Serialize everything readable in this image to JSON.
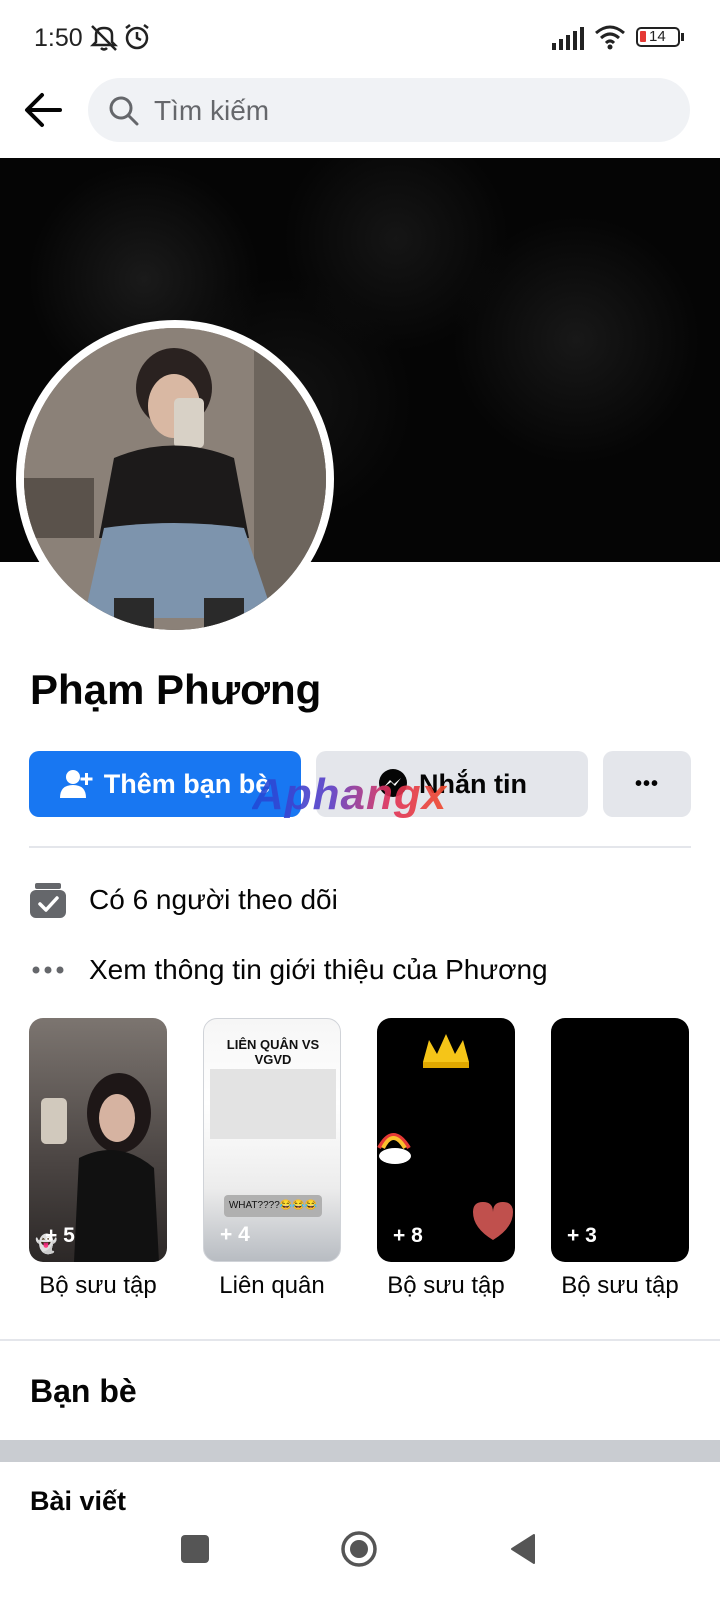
{
  "status_bar": {
    "time": "1:50",
    "battery": "14",
    "icons": [
      "mute-icon",
      "alarm-icon",
      "signal-icon",
      "wifi-icon",
      "battery-icon"
    ]
  },
  "search": {
    "placeholder": "Tìm kiếm"
  },
  "profile": {
    "name": "Phạm Phương",
    "add_friend_label": "Thêm bạn bè",
    "message_label": "Nhắn tin",
    "more_label": "•••",
    "followers_text": "Có 6 người theo dõi",
    "about_text": "Xem thông tin giới thiệu của Phương"
  },
  "watermark": "Aphangx",
  "featured": [
    {
      "label": "Bộ sưu tập",
      "count": "+ 5"
    },
    {
      "label": "Liên quân",
      "count": "+ 4",
      "caption_top": "LIÊN QUÂN VS VGVD",
      "caption_bottom": "WHAT????😂😂😂"
    },
    {
      "label": "Bộ sưu tập",
      "count": "+ 8"
    },
    {
      "label": "Bộ sưu tập",
      "count": "+ 3"
    }
  ],
  "sections": {
    "friends": "Bạn bè",
    "posts": "Bài viết"
  },
  "colors": {
    "primary_blue": "#1877f2",
    "secondary_button": "#e4e6eb",
    "search_bg": "#f0f2f5"
  }
}
